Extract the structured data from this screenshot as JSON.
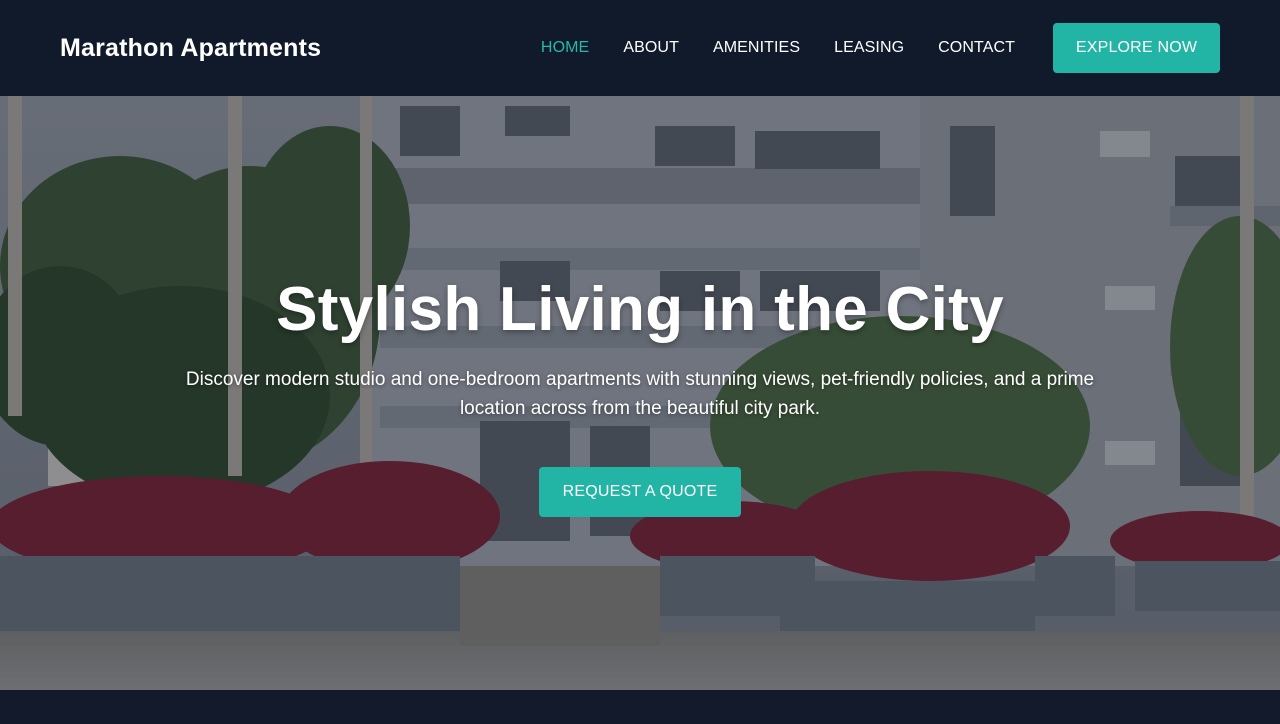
{
  "navbar": {
    "brand": "Marathon Apartments",
    "links": [
      {
        "label": "HOME",
        "active": true
      },
      {
        "label": "ABOUT",
        "active": false
      },
      {
        "label": "AMENITIES",
        "active": false
      },
      {
        "label": "LEASING",
        "active": false
      },
      {
        "label": "CONTACT",
        "active": false
      }
    ],
    "cta_label": "EXPLORE NOW"
  },
  "hero": {
    "title": "Stylish Living in the City",
    "subtitle": "Discover modern studio and one-bedroom apartments with stunning views, pet-friendly policies, and a prime location across from the beautiful city park.",
    "cta_label": "REQUEST A QUOTE"
  },
  "colors": {
    "nav_bg": "#111a2b",
    "accent": "#22b5a5",
    "active_link": "#27b8aa",
    "text": "#ffffff"
  }
}
